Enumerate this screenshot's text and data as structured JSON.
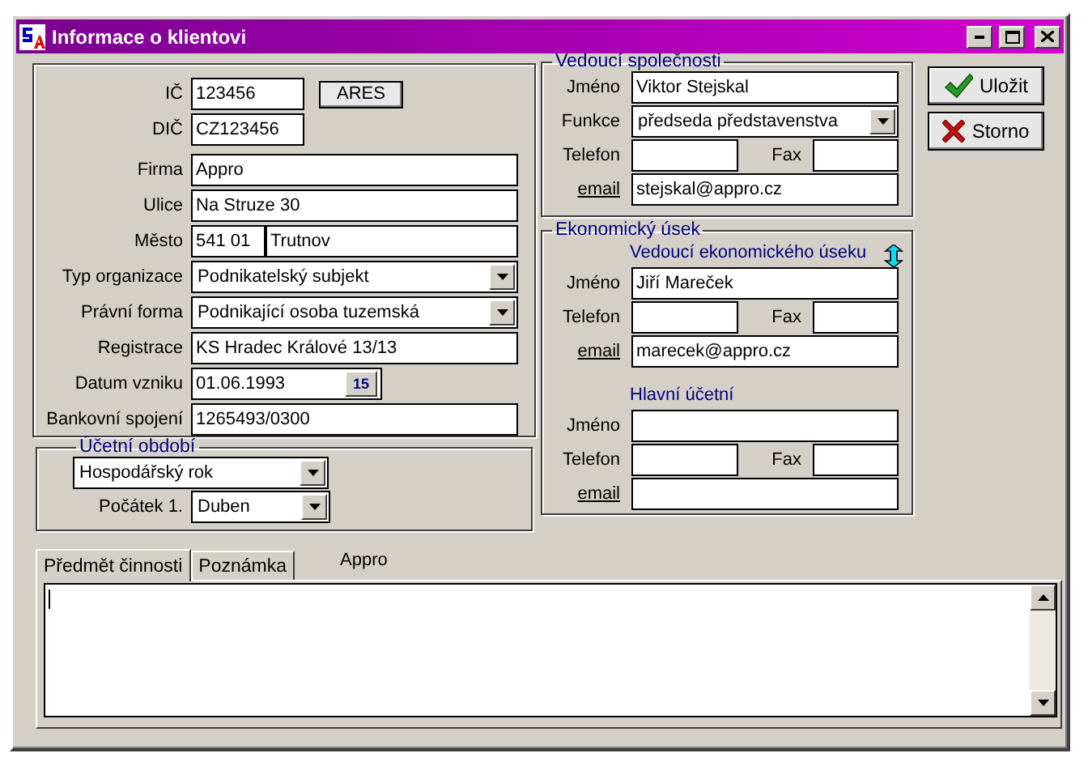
{
  "window": {
    "title": "Informace o klientovi"
  },
  "company_fields": [
    {
      "kind": "id",
      "label": "IČ",
      "value": "123456",
      "action": "ARES"
    },
    {
      "kind": "short",
      "label": "DIČ",
      "value": "CZ123456"
    },
    {
      "kind": "text",
      "label": "Firma",
      "value": "Appro"
    },
    {
      "kind": "text",
      "label": "Ulice",
      "value": "Na Struze 30"
    },
    {
      "kind": "city",
      "label": "Město",
      "value": "541 01",
      "value2": "Trutnov"
    },
    {
      "kind": "select",
      "label": "Typ organizace",
      "value": "Podnikatelský subjekt"
    },
    {
      "kind": "select",
      "label": "Právní forma",
      "value": "Podnikající osoba tuzemská"
    },
    {
      "kind": "text",
      "label": "Registrace",
      "value": "KS Hradec Králové 13/13"
    },
    {
      "kind": "date",
      "label": "Datum vzniku",
      "value": "01.06.1993",
      "action": "15"
    },
    {
      "kind": "text",
      "label": "Bankovní spojení",
      "value": "1265493/0300"
    }
  ],
  "accounting_period": {
    "title": "Účetní období",
    "period": "Hospodářský rok",
    "start_label": "Počátek 1.",
    "start": "Duben"
  },
  "management": {
    "title": "Vedoucí společnosti",
    "name_label": "Jméno",
    "name": "Viktor Stejskal",
    "function_label": "Funkce",
    "function": "předseda představenstva",
    "phone_label": "Telefon",
    "fax_label": "Fax",
    "email_label": "email",
    "email": "stejskal@appro.cz"
  },
  "economic": {
    "title": "Ekonomický úsek",
    "groups": [
      {
        "heading": "Vedoucí ekonomického úseku",
        "name_label": "Jméno",
        "name": "Jiří Mareček",
        "phone_label": "Telefon",
        "fax_label": "Fax",
        "email_label": "email",
        "email": "marecek@appro.cz"
      },
      {
        "heading": "Hlavní účetní",
        "name_label": "Jméno",
        "phone_label": "Telefon",
        "fax_label": "Fax",
        "email_label": "email"
      }
    ]
  },
  "buttons": [
    {
      "kind": "save",
      "label": "Uložit"
    },
    {
      "kind": "cancel",
      "label": "Storno"
    }
  ],
  "tabs": [
    {
      "label": "Předmět činnosti",
      "selected": true
    },
    {
      "label": "Poznámka",
      "selected": false
    }
  ],
  "tab_caption": "Appro"
}
